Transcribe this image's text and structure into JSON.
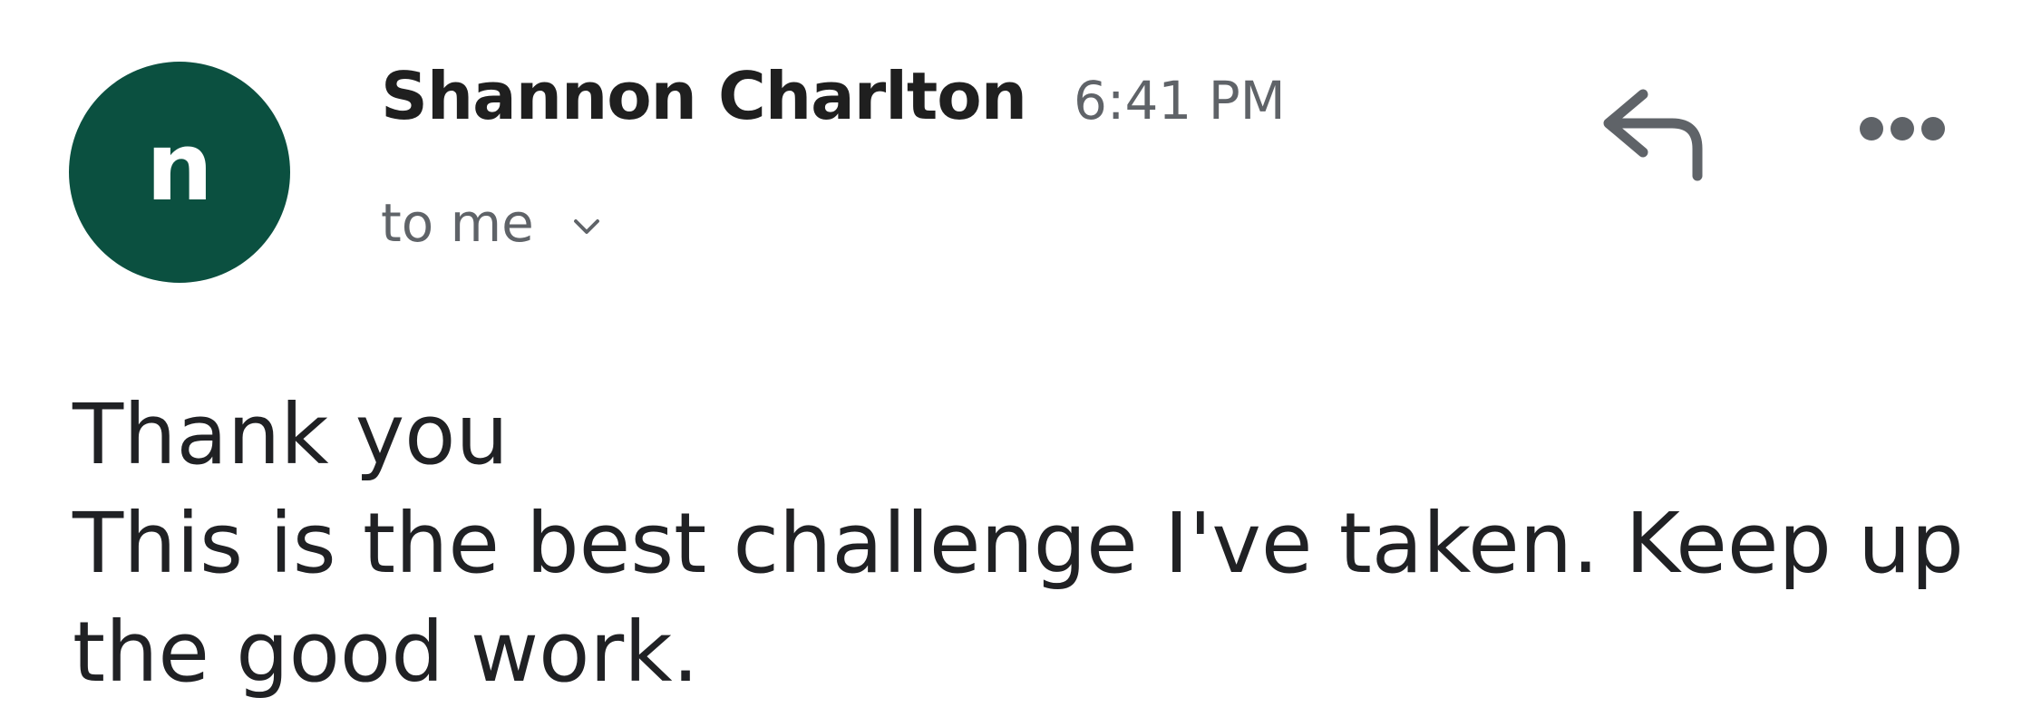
{
  "message": {
    "avatar_letter": "n",
    "avatar_color": "#0b5040",
    "sender_name": "Shannon Charlton",
    "time": "6:41 PM",
    "recipient_label": "to me",
    "actions": {
      "reply_icon": "reply-arrow",
      "more_icon": "three-dots-horizontal"
    },
    "body": {
      "line1": "Thank you",
      "line2": "This is the best challenge I've taken. Keep up the good work."
    }
  }
}
